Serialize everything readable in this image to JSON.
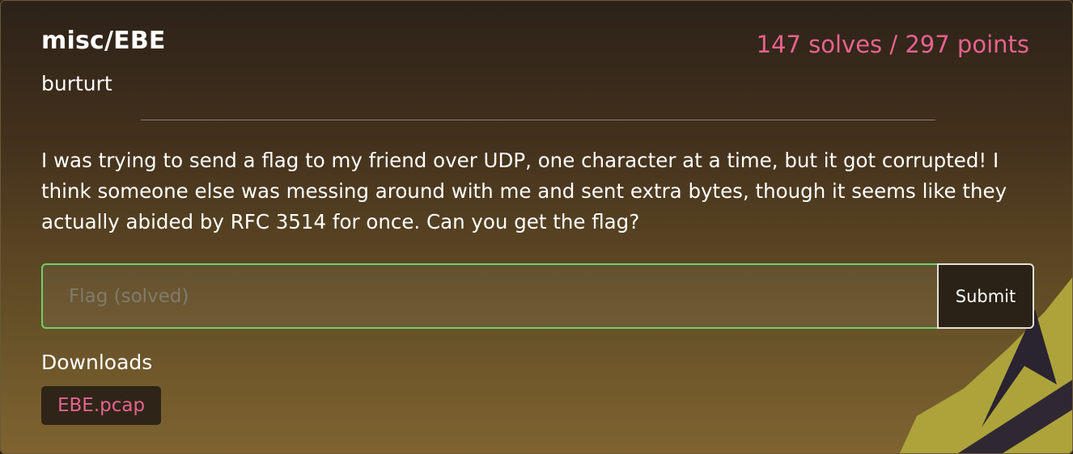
{
  "challenge": {
    "title": "misc/EBE",
    "score": "147 solves / 297 points",
    "author": "burturt",
    "description": "I was trying to send a flag to my friend over UDP, one character at a time, but it got corrupted! I think someone else was messing around with me and sent extra bytes, though it seems like they actually abided by RFC 3514 for once. Can you get the flag?"
  },
  "flag_form": {
    "input_value": "",
    "placeholder": "Flag (solved)",
    "submit_label": "Submit"
  },
  "downloads": {
    "heading": "Downloads",
    "files": [
      {
        "name": "EBE.pcap"
      }
    ]
  },
  "colors": {
    "accent_pink": "#e8638f",
    "success_green": "#6fd06a",
    "deco_yellow": "#ada33b",
    "deco_dark": "#2a2330"
  }
}
